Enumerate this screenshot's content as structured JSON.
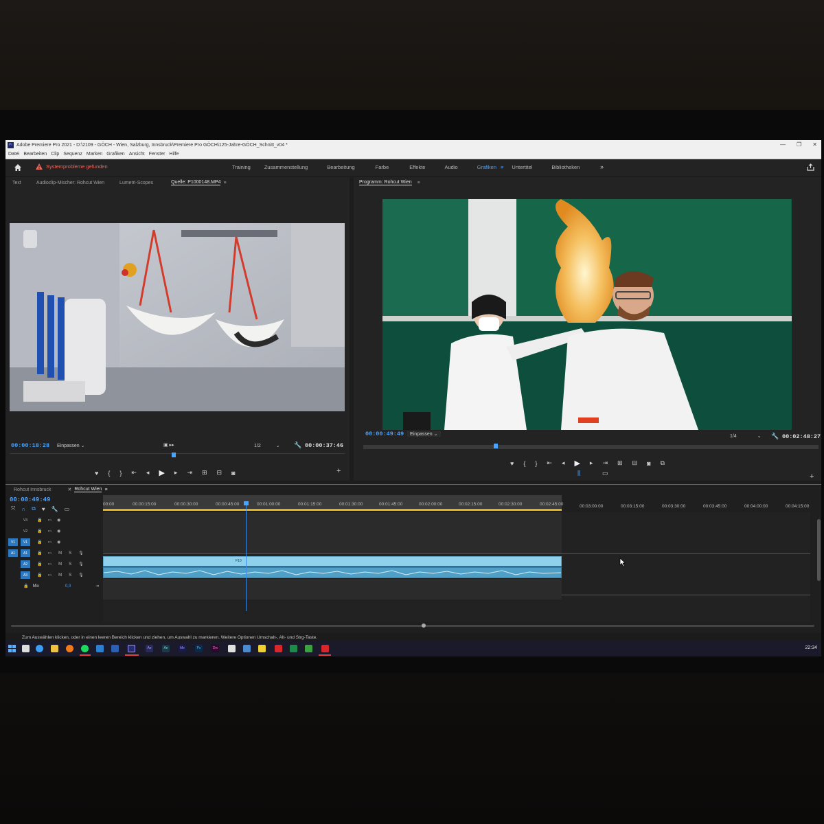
{
  "window": {
    "title": "Adobe Premiere Pro 2021 - D:\\2109 - GÖCH - Wien, Salzburg, Innsbruck\\Premiere Pro GÖCH\\125-Jahre-GÖCH_Schnitt_v04 *",
    "app_badge": "Pr"
  },
  "menu": [
    "Datei",
    "Bearbeiten",
    "Clip",
    "Sequenz",
    "Marken",
    "Grafiken",
    "Ansicht",
    "Fenster",
    "Hilfe"
  ],
  "header": {
    "warning": "Systemprobleme gefunden",
    "workspaces": [
      "Training",
      "Zusammenstellung",
      "Bearbeitung",
      "Farbe",
      "Effekte",
      "Audio",
      "Grafiken",
      "Untertitel",
      "Bibliotheken"
    ],
    "active_workspace": "Grafiken",
    "more": "»"
  },
  "source_panel": {
    "tabs": [
      "Text",
      "Audioclip-Mischer: Rohcut Wien",
      "Lumetri-Scopes",
      "Quelle: P1000148.MP4"
    ],
    "menu_glyph": "≡",
    "timecode": "00:00:18:28",
    "fit": "Einpassen",
    "resolution": "1/2",
    "duration": "00:00:37:46"
  },
  "program_panel": {
    "title": "Programm: Rohcut Wien",
    "menu_glyph": "≡",
    "timecode": "00:00:49:49",
    "fit": "Einpassen",
    "resolution": "1/4",
    "duration": "00:02:48:27"
  },
  "timeline": {
    "tabs": [
      "Rohcut Innsbruck",
      "Rohcut Wien"
    ],
    "active_tab": "Rohcut Wien",
    "timecode": "00:00:49:49",
    "ruler": [
      "00:00",
      "00:00:15:00",
      "00:00:30:00",
      "00:00:45:00",
      "00:01:00:00",
      "00:01:15:00",
      "00:01:30:00",
      "00:01:45:00",
      "00:02:00:00",
      "00:02:15:00",
      "00:02:30:00",
      "00:02:45:00",
      "00:03:00:00",
      "00:03:15:00",
      "00:03:30:00",
      "00:03:45:00",
      "00:04:00:00",
      "00:04:15:00"
    ],
    "video_tracks": [
      "V3",
      "V2",
      "V1"
    ],
    "audio_tracks": [
      "A1",
      "A2",
      "A3"
    ],
    "mix_label": "Mix",
    "mix_value": "0,0",
    "clip_label": "F10",
    "track_flags": [
      "M",
      "S"
    ]
  },
  "status": {
    "message": "Zum Auswählen klicken, oder in einen leeren Bereich klicken und ziehen, um Auswahl zu markieren. Weitere Optionen Umschalt-, Alt- und Strg-Taste."
  },
  "taskbar": {
    "time": "22:34",
    "apps": [
      "Ae",
      "Ae",
      "Me",
      "Ps",
      "Dw"
    ]
  },
  "colors": {
    "accent": "#4aa3ff",
    "warning": "#e8675c",
    "clip_video": "#8fd0ea",
    "clip_audio": "#4f9fc7",
    "playhead": "#3b8ee6"
  }
}
